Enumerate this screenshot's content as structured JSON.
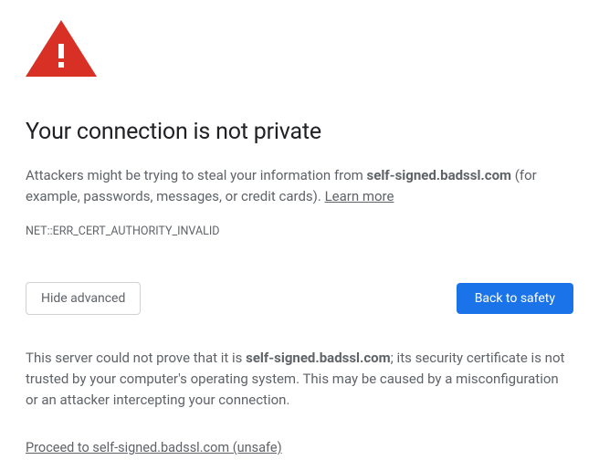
{
  "icon": {
    "name": "warning-triangle",
    "color": "#d93025"
  },
  "heading": "Your connection is not private",
  "subtext": {
    "prefix": "Attackers might be trying to steal your information from ",
    "host": "self-signed.badssl.com",
    "suffix": " (for example, passwords, messages, or credit cards). ",
    "learn_more": "Learn more"
  },
  "error_code": "NET::ERR_CERT_AUTHORITY_INVALID",
  "buttons": {
    "advanced": "Hide advanced",
    "back": "Back to safety"
  },
  "explanation": {
    "prefix": "This server could not prove that it is ",
    "host": "self-signed.badssl.com",
    "suffix": "; its security certificate is not trusted by your computer's operating system. This may be caused by a misconfiguration or an attacker intercepting your connection."
  },
  "proceed": {
    "prefix": "Proceed to ",
    "host": "self-signed.badssl.com",
    "suffix": " (unsafe)"
  }
}
